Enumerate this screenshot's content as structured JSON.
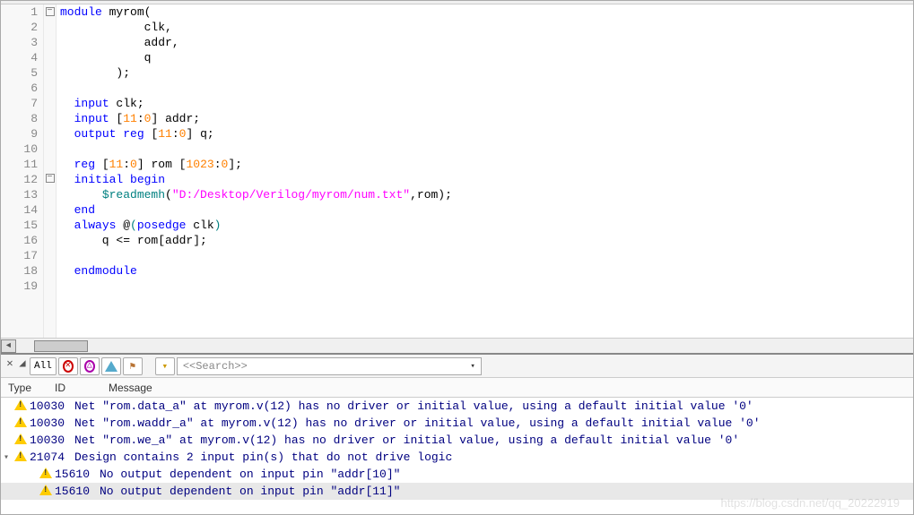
{
  "code": {
    "lines": [
      {
        "n": 1,
        "fold": "minus",
        "segs": [
          {
            "t": "module",
            "c": "kw"
          },
          {
            "t": " myrom("
          }
        ]
      },
      {
        "n": 2,
        "fold": "",
        "segs": [
          {
            "t": "            clk,"
          }
        ]
      },
      {
        "n": 3,
        "fold": "",
        "segs": [
          {
            "t": "            addr,"
          }
        ]
      },
      {
        "n": 4,
        "fold": "",
        "segs": [
          {
            "t": "            q"
          }
        ]
      },
      {
        "n": 5,
        "fold": "",
        "segs": [
          {
            "t": "        );"
          }
        ]
      },
      {
        "n": 6,
        "fold": "",
        "segs": [
          {
            "t": ""
          }
        ]
      },
      {
        "n": 7,
        "fold": "",
        "segs": [
          {
            "t": "  "
          },
          {
            "t": "input",
            "c": "kw"
          },
          {
            "t": " clk;"
          }
        ]
      },
      {
        "n": 8,
        "fold": "",
        "segs": [
          {
            "t": "  "
          },
          {
            "t": "input",
            "c": "kw"
          },
          {
            "t": " ["
          },
          {
            "t": "11",
            "c": "num"
          },
          {
            "t": ":"
          },
          {
            "t": "0",
            "c": "num"
          },
          {
            "t": "] addr;"
          }
        ]
      },
      {
        "n": 9,
        "fold": "",
        "segs": [
          {
            "t": "  "
          },
          {
            "t": "output",
            "c": "kw"
          },
          {
            "t": " "
          },
          {
            "t": "reg",
            "c": "kw"
          },
          {
            "t": " ["
          },
          {
            "t": "11",
            "c": "num"
          },
          {
            "t": ":"
          },
          {
            "t": "0",
            "c": "num"
          },
          {
            "t": "] q;"
          }
        ]
      },
      {
        "n": 10,
        "fold": "",
        "segs": [
          {
            "t": ""
          }
        ]
      },
      {
        "n": 11,
        "fold": "",
        "segs": [
          {
            "t": "  "
          },
          {
            "t": "reg",
            "c": "kw"
          },
          {
            "t": " ["
          },
          {
            "t": "11",
            "c": "num"
          },
          {
            "t": ":"
          },
          {
            "t": "0",
            "c": "num"
          },
          {
            "t": "] rom ["
          },
          {
            "t": "1023",
            "c": "num"
          },
          {
            "t": ":"
          },
          {
            "t": "0",
            "c": "num"
          },
          {
            "t": "];"
          }
        ]
      },
      {
        "n": 12,
        "fold": "minus",
        "segs": [
          {
            "t": "  "
          },
          {
            "t": "initial",
            "c": "kw"
          },
          {
            "t": " "
          },
          {
            "t": "begin",
            "c": "kw"
          }
        ]
      },
      {
        "n": 13,
        "fold": "",
        "segs": [
          {
            "t": "      "
          },
          {
            "t": "$readmemh",
            "c": "sys"
          },
          {
            "t": "("
          },
          {
            "t": "\"D:/Desktop/Verilog/myrom/num.txt\"",
            "c": "str"
          },
          {
            "t": ",rom);"
          }
        ]
      },
      {
        "n": 14,
        "fold": "",
        "segs": [
          {
            "t": "  "
          },
          {
            "t": "end",
            "c": "kw"
          }
        ]
      },
      {
        "n": 15,
        "fold": "",
        "segs": [
          {
            "t": "  "
          },
          {
            "t": "always",
            "c": "kw"
          },
          {
            "t": " @"
          },
          {
            "t": "(",
            "c": "paren"
          },
          {
            "t": "posedge",
            "c": "kw"
          },
          {
            "t": " clk"
          },
          {
            "t": ")",
            "c": "paren"
          }
        ]
      },
      {
        "n": 16,
        "fold": "",
        "segs": [
          {
            "t": "      q <= rom[addr];"
          }
        ]
      },
      {
        "n": 17,
        "fold": "",
        "segs": [
          {
            "t": ""
          }
        ]
      },
      {
        "n": 18,
        "fold": "",
        "segs": [
          {
            "t": "  "
          },
          {
            "t": "endmodule",
            "c": "kw"
          }
        ]
      },
      {
        "n": 19,
        "fold": "",
        "segs": [
          {
            "t": ""
          }
        ]
      }
    ]
  },
  "messages": {
    "toolbar": {
      "all_label": "All",
      "search_placeholder": "<<Search>>"
    },
    "columns": {
      "type": "Type",
      "id": "ID",
      "message": "Message"
    },
    "rows": [
      {
        "level": 1,
        "exp": "",
        "icon": "warn",
        "id": "10030",
        "text": "Net \"rom.data_a\" at myrom.v(12) has no driver or initial value, using a default initial value '0'",
        "sel": false
      },
      {
        "level": 1,
        "exp": "",
        "icon": "warn",
        "id": "10030",
        "text": "Net \"rom.waddr_a\" at myrom.v(12) has no driver or initial value, using a default initial value '0'",
        "sel": false
      },
      {
        "level": 1,
        "exp": "",
        "icon": "warn",
        "id": "10030",
        "text": "Net \"rom.we_a\" at myrom.v(12) has no driver or initial value, using a default initial value '0'",
        "sel": false
      },
      {
        "level": 1,
        "exp": "▾",
        "icon": "warn",
        "id": "21074",
        "text": "Design contains 2 input pin(s) that do not drive logic",
        "sel": false
      },
      {
        "level": 2,
        "exp": "",
        "icon": "warn",
        "id": "15610",
        "text": "No output dependent on input pin \"addr[10]\"",
        "sel": false
      },
      {
        "level": 2,
        "exp": "",
        "icon": "warn",
        "id": "15610",
        "text": "No output dependent on input pin \"addr[11]\"",
        "sel": true
      }
    ]
  },
  "watermark": "https://blog.csdn.net/qq_20222919"
}
